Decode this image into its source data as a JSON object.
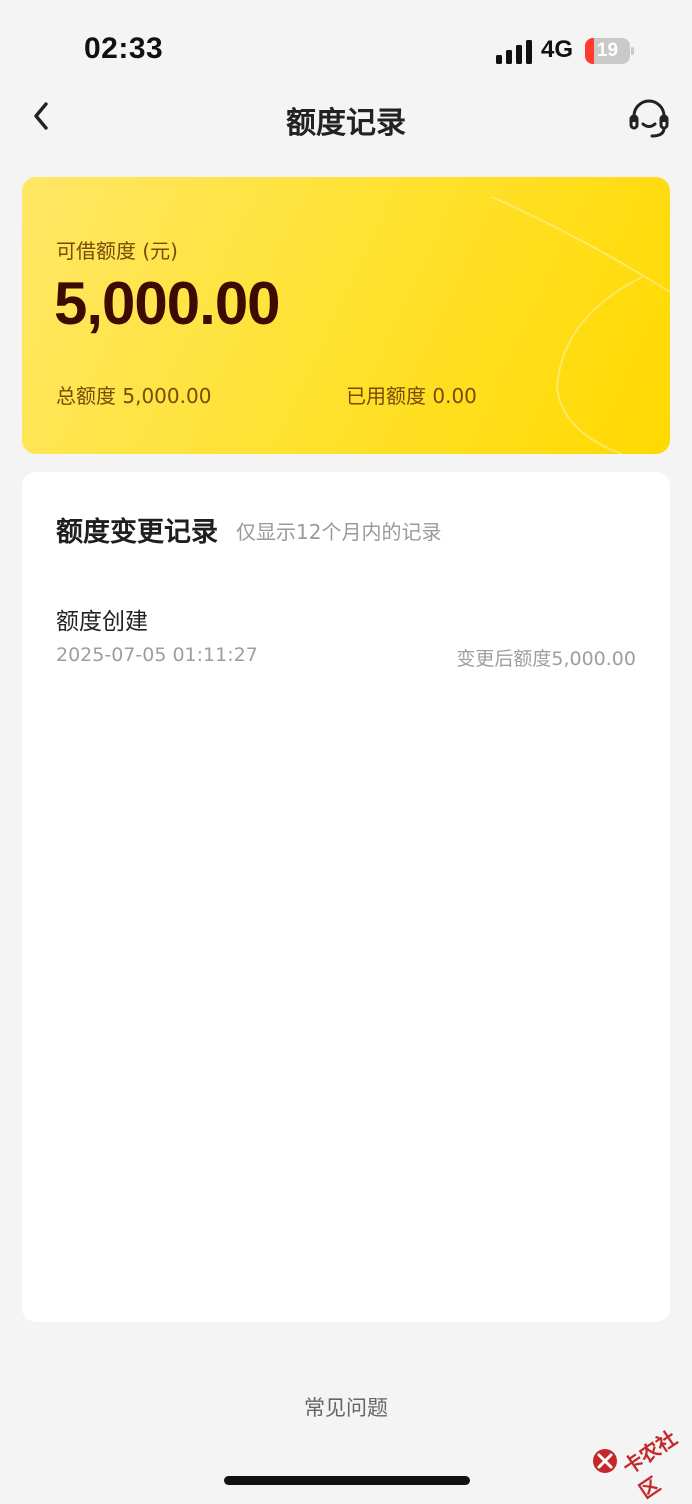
{
  "status_bar": {
    "time": "02:33",
    "network": "4G",
    "battery_level": "19",
    "battery_color": "#ff3b30"
  },
  "nav": {
    "title": "额度记录",
    "back_icon": "chevron-left-icon",
    "service_icon": "headset-icon"
  },
  "credit_card": {
    "available_label": "可借额度 (元)",
    "available_amount": "5,000.00",
    "total_text": "总额度 5,000.00",
    "used_text": "已用额度 0.00",
    "accent_color": "#ffdd00",
    "amount_color": "#3d0b02"
  },
  "records": {
    "title": "额度变更记录",
    "hint": "仅显示12个月内的记录",
    "items": [
      {
        "name": "额度创建",
        "time": "2025-07-05 01:11:27",
        "after": "变更后额度5,000.00"
      }
    ]
  },
  "footer": {
    "faq_label": "常见问题"
  },
  "watermark": {
    "text": "卡农社区"
  }
}
